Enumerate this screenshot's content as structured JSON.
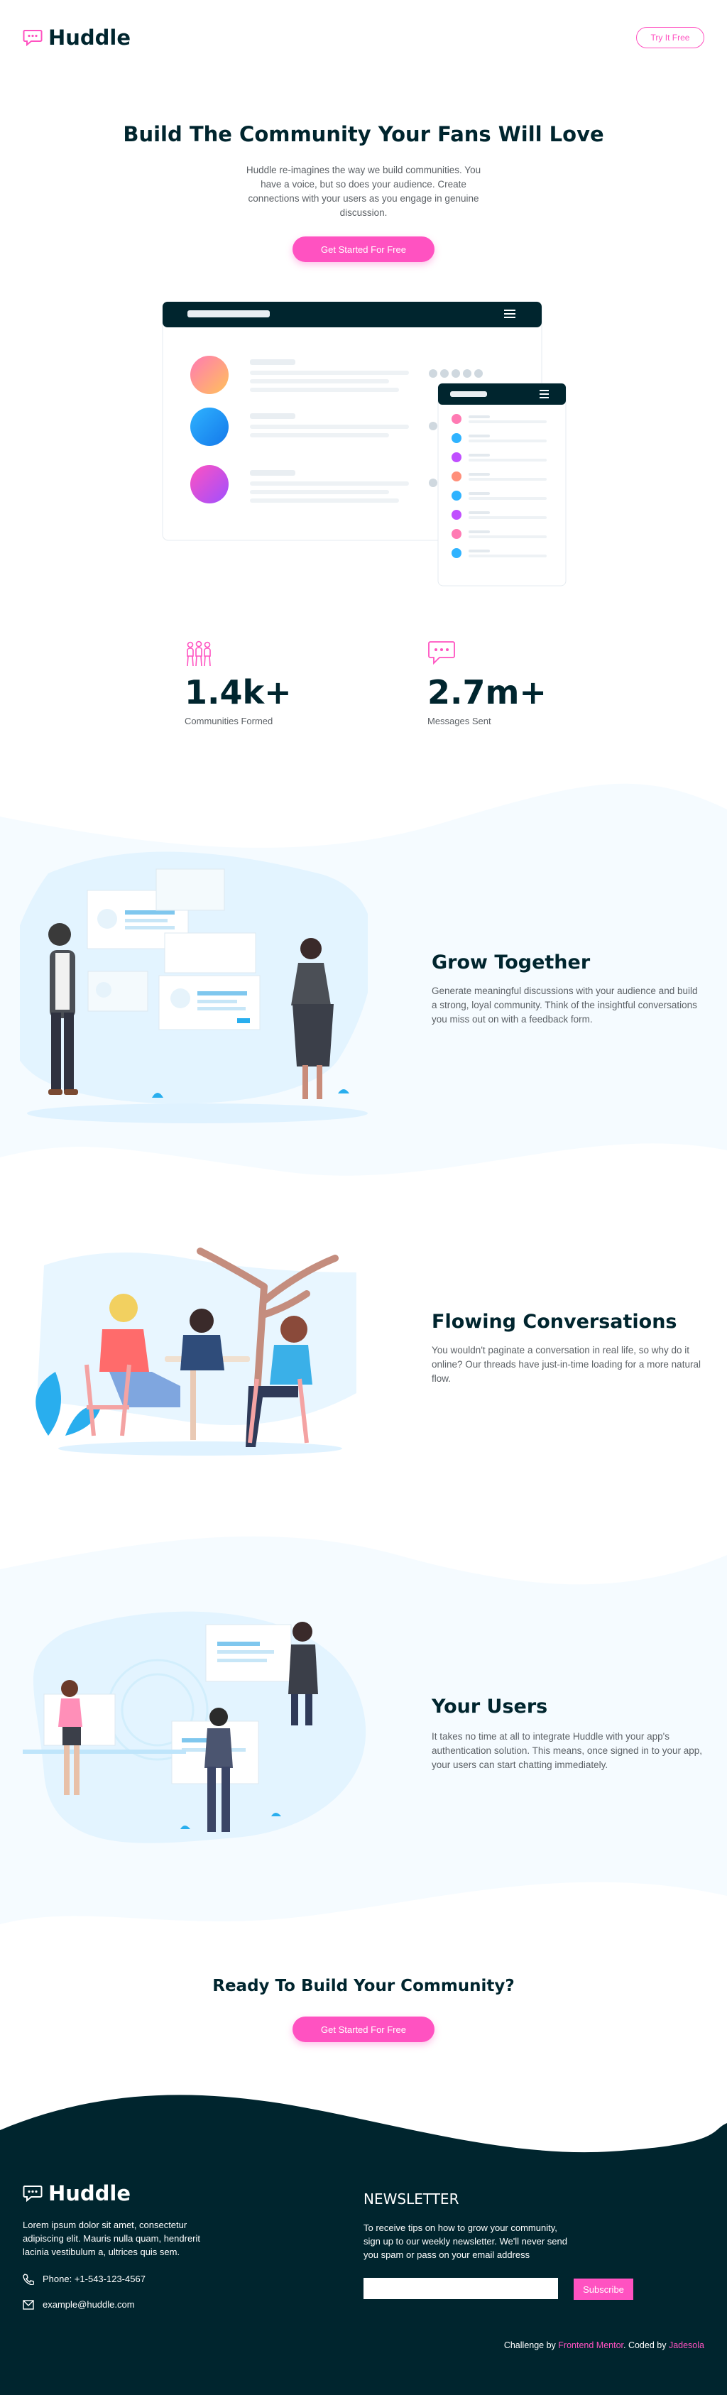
{
  "header": {
    "logo_text": "Huddle",
    "cta_label": "Try It Free",
    "logo_icon": "chat-bubble-icon"
  },
  "hero": {
    "title": "Build The Community Your Fans Will Love",
    "description": "Huddle re-imagines the way we build communities. You have a voice, but so does your audience. Create connections with your users as you engage in genuine discussion.",
    "cta_label": "Get Started For Free"
  },
  "stats": [
    {
      "value": "1.4k+",
      "label": "Communities Formed",
      "icon": "communities-icon"
    },
    {
      "value": "2.7m+",
      "label": "Messages Sent",
      "icon": "messages-icon"
    }
  ],
  "features": [
    {
      "title": "Grow Together",
      "description": "Generate meaningful discussions with your audience and build a strong, loyal community. Think of the insightful conversations you miss out on with a feedback form."
    },
    {
      "title": "Flowing Conversations",
      "description": "You wouldn't paginate a conversation in real life, so why do it online? Our threads have just-in-time loading for a more natural flow."
    },
    {
      "title": "Your Users",
      "description": "It takes no time at all to integrate Huddle with your app's authentication solution. This means, once signed in to your app, your users can start chatting immediately."
    }
  ],
  "cta": {
    "title": "Ready To Build Your Community?",
    "button_label": "Get Started For Free"
  },
  "footer": {
    "logo_text": "Huddle",
    "about": "Lorem ipsum dolor sit amet, consectetur adipiscing elit. Mauris nulla quam, hendrerit lacinia vestibulum a, ultrices quis sem.",
    "phone": "Phone: +1-543-123-4567",
    "email": "example@huddle.com",
    "newsletter_title": "NEWSLETTER",
    "newsletter_text": "To receive tips on how to grow your community, sign up to our weekly newsletter. We'll never send you spam or pass on your email address",
    "email_placeholder": "",
    "subscribe_label": "Subscribe",
    "attribution_prefix": "Challenge by",
    "attribution_link": "Frontend Mentor",
    "attribution_mid": ". Coded by",
    "attribution_author": "Jadesola"
  },
  "colors": {
    "pink": "#ff52c1",
    "dark": "#00252e",
    "light_blue_bg": "#f5fbff"
  }
}
